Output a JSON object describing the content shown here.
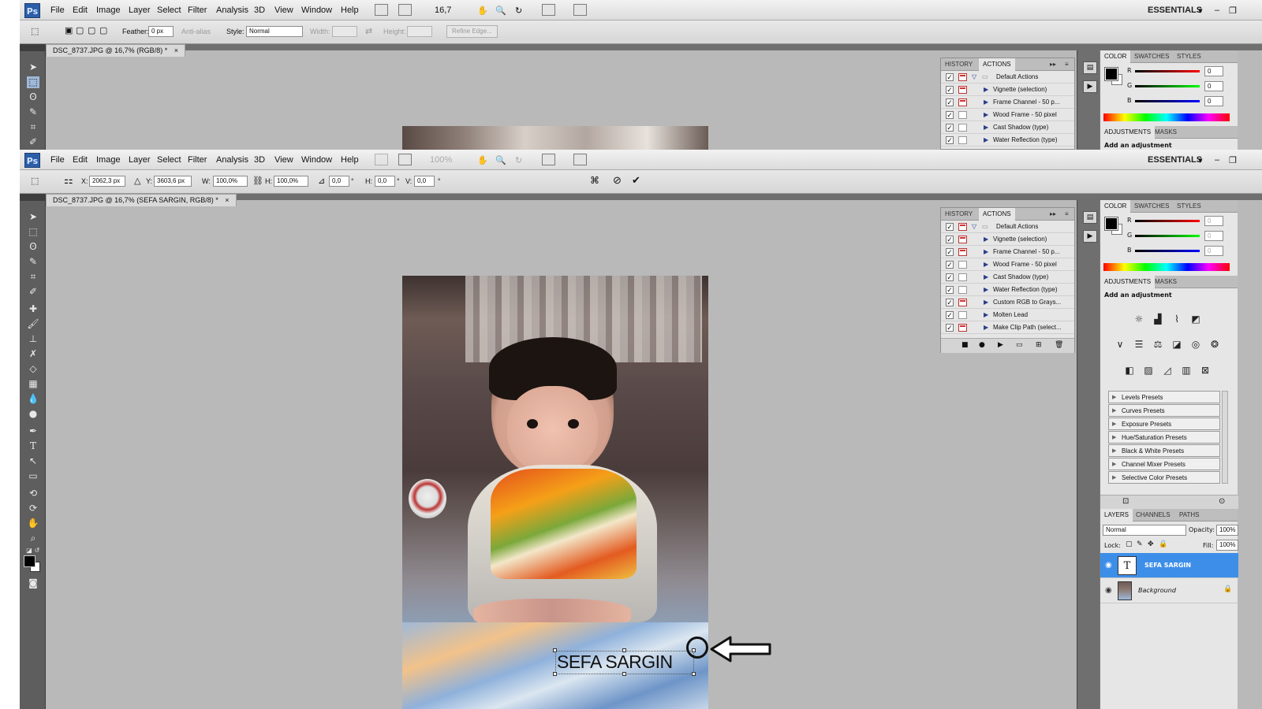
{
  "menu": {
    "logo": "Ps",
    "items": [
      "File",
      "Edit",
      "Image",
      "Layer",
      "Select",
      "Filter",
      "Analysis",
      "3D",
      "View",
      "Window",
      "Help"
    ],
    "zoom_level": "16,7",
    "zoom_level_dim": "100%",
    "workspace": "ESSENTIALS"
  },
  "top_options": {
    "feather_label": "Feather:",
    "feather_value": "0 px",
    "antialias_label": "Anti-alias",
    "style_label": "Style:",
    "style_value": "Normal",
    "width_label": "Width:",
    "height_label": "Height:",
    "refine_edge": "Refine Edge..."
  },
  "transform_options": {
    "x_label": "X:",
    "x_value": "2062,3 px",
    "y_label": "Y:",
    "y_value": "3603,6 px",
    "w_label": "W:",
    "w_value": "100,0%",
    "h_label": "H:",
    "h_value": "100,0%",
    "angle_value": "0,0",
    "hskew_label": "H:",
    "hskew_value": "0,0",
    "vskew_label": "V:",
    "vskew_value": "0,0",
    "deg": "°"
  },
  "doc_tabs": {
    "top": "DSC_8737.JPG @ 16,7% (RGB/8) *",
    "bottom": "DSC_8737.JPG @ 16,7% (SEFA SARGIN, RGB/8) *",
    "close": "×"
  },
  "history_actions": {
    "tab_history": "HISTORY",
    "tab_actions": "ACTIONS",
    "set_name": "Default Actions",
    "actions": [
      "Vignette (selection)",
      "Frame Channel - 50 p...",
      "Wood Frame - 50 pixel",
      "Cast Shadow (type)",
      "Water Reflection (type)",
      "Custom RGB to Grays...",
      "Molten Lead",
      "Make Clip Path (select..."
    ]
  },
  "color_panel": {
    "tab_color": "COLOR",
    "tab_swatches": "SWATCHES",
    "tab_styles": "STYLES",
    "r_label": "R",
    "g_label": "G",
    "b_label": "B",
    "r_value": "0",
    "g_value": "0",
    "b_value": "0"
  },
  "adjustments": {
    "tab_adjustments": "ADJUSTMENTS",
    "tab_masks": "MASKS",
    "heading": "Add an adjustment",
    "presets": [
      "Levels Presets",
      "Curves Presets",
      "Exposure Presets",
      "Hue/Saturation Presets",
      "Black & White Presets",
      "Channel Mixer Presets",
      "Selective Color Presets"
    ]
  },
  "layers": {
    "tab_layers": "LAYERS",
    "tab_channels": "CHANNELS",
    "tab_paths": "PATHS",
    "blend_mode": "Normal",
    "opacity_label": "Opacity:",
    "opacity_value": "100%",
    "lock_label": "Lock:",
    "fill_label": "Fill:",
    "fill_value": "100%",
    "items": [
      {
        "name": "SEFA SARGIN",
        "type": "T",
        "selected": true
      },
      {
        "name": "Background",
        "type": "image",
        "selected": false
      }
    ]
  },
  "canvas_text": "SEFA SARGIN",
  "colors": {
    "selected_layer": "#3d8ee8",
    "workspace_gray": "#b9b9b9",
    "toolbox_dark": "#5e5e5e"
  }
}
